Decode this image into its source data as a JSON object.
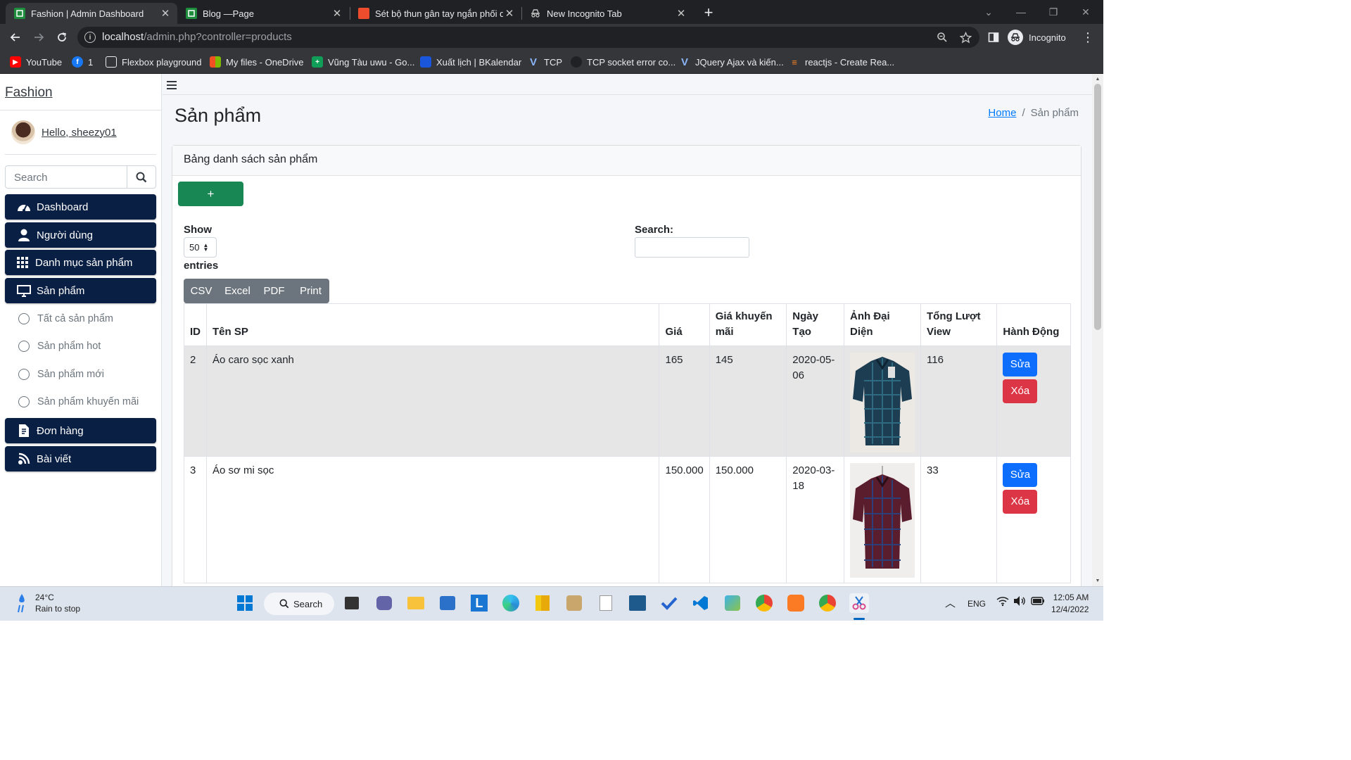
{
  "browser": {
    "tabs": [
      {
        "title": "Fashion | Admin Dashboard",
        "active": true
      },
      {
        "title": "Blog —Page",
        "active": false
      },
      {
        "title": "Sét bộ thun gân tay ngắn phối q",
        "active": false
      },
      {
        "title": "New Incognito Tab",
        "active": false
      }
    ],
    "url_host": "localhost",
    "url_path": "/admin.php?controller=products",
    "profile_label": "Incognito",
    "bookmarks": [
      "YouTube",
      "1",
      "Flexbox playground",
      "My files - OneDrive",
      "Vũng Tàu uwu - Go...",
      "Xuất lịch | BKalendar",
      "TCP",
      "TCP socket error co...",
      "JQuery Ajax và kiến...",
      "reactjs - Create Rea..."
    ]
  },
  "sidebar": {
    "brand": "Fashion",
    "user_greeting": "Hello, sheezy01",
    "search_placeholder": "Search",
    "menu": [
      {
        "label": "Dashboard",
        "icon": "gauge-icon"
      },
      {
        "label": "Người dùng",
        "icon": "user-icon"
      },
      {
        "label": "Danh mục sản phẩm",
        "icon": "grid-icon"
      },
      {
        "label": "Sản phẩm",
        "icon": "monitor-icon"
      },
      {
        "label": "Đơn hàng",
        "icon": "invoice-icon"
      },
      {
        "label": "Bài viết",
        "icon": "blog-icon"
      }
    ],
    "submenu": [
      "Tất cả sản phẩm",
      "Sản phẩm hot",
      "Sản phẩm mới",
      "Sản phẩm khuyến mãi"
    ]
  },
  "header": {
    "title": "Sản phẩm",
    "breadcrumb_home": "Home",
    "breadcrumb_sep": "/",
    "breadcrumb_current": "Sản phẩm"
  },
  "card": {
    "title": "Bảng danh sách sản phẩm",
    "add_label": "+",
    "show_label": "Show",
    "entries_value": "50",
    "entries_label": "entries",
    "search_label": "Search:",
    "export_buttons": [
      "CSV",
      "Excel",
      "PDF",
      "Print"
    ]
  },
  "table": {
    "columns": [
      "ID",
      "Tên SP",
      "Giá",
      "Giá khuyến mãi",
      "Ngày Tạo",
      "Ảnh Đại Diện",
      "Tổng Lượt View",
      "Hành Động"
    ],
    "rows": [
      {
        "id": "2",
        "name": "Áo caro sọc xanh",
        "price": "165",
        "sale_price": "145",
        "created": "2020-05-06",
        "views": "116",
        "image": "blue-plaid-shirt"
      },
      {
        "id": "3",
        "name": "Áo sơ mi sọc",
        "price": "150.000",
        "sale_price": "150.000",
        "created": "2020-03-18",
        "views": "33",
        "image": "red-plaid-shirt"
      }
    ],
    "edit_label": "Sửa",
    "delete_label": "Xóa"
  },
  "taskbar": {
    "weather_temp": "24°C",
    "weather_desc": "Rain to stop",
    "search_label": "Search",
    "language": "ENG",
    "time": "12:05 AM",
    "date": "12/4/2022"
  },
  "colors": {
    "menu_bg": "#0a1f44",
    "add_button": "#198754",
    "edit_button": "#0d6efd",
    "delete_button": "#dc3545",
    "export_group": "#6c757d"
  }
}
